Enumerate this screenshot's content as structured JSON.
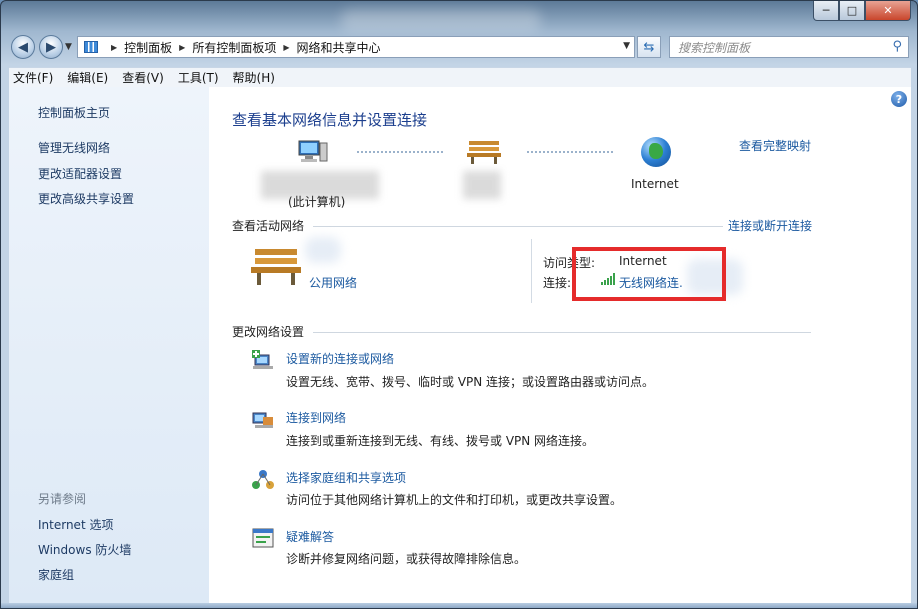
{
  "window": {
    "title": "",
    "caption_minimize": "─",
    "caption_maximize": "□",
    "caption_close": "✕"
  },
  "address_bar": {
    "breadcrumbs": [
      "控制面板",
      "所有控制面板项",
      "网络和共享中心"
    ],
    "search_placeholder": "搜索控制面板"
  },
  "menu": [
    "文件(F)",
    "编辑(E)",
    "查看(V)",
    "工具(T)",
    "帮助(H)"
  ],
  "sidebar": {
    "home": "控制面板主页",
    "links": [
      "管理无线网络",
      "更改适配器设置",
      "更改高级共享设置"
    ],
    "see_also_title": "另请参阅",
    "see_also": [
      "Internet 选项",
      "Windows 防火墙",
      "家庭组"
    ]
  },
  "main": {
    "title": "查看基本网络信息并设置连接",
    "full_map_link": "查看完整映射",
    "map": {
      "computer_label": "(此计算机)",
      "internet_label": "Internet"
    },
    "active_networks": {
      "heading": "查看活动网络",
      "connect_link": "连接或断开连接",
      "network_type": "公用网络",
      "access_type_label": "访问类型:",
      "access_type_value": "Internet",
      "connection_label": "连接:",
      "connection_value": "无线网络连."
    },
    "change_settings": {
      "heading": "更改网络设置",
      "tasks": [
        {
          "icon": "new-connection-icon",
          "title": "设置新的连接或网络",
          "desc": "设置无线、宽带、拨号、临时或 VPN 连接；或设置路由器或访问点。"
        },
        {
          "icon": "connect-network-icon",
          "title": "连接到网络",
          "desc": "连接到或重新连接到无线、有线、拨号或 VPN 网络连接。"
        },
        {
          "icon": "homegroup-icon",
          "title": "选择家庭组和共享选项",
          "desc": "访问位于其他网络计算机上的文件和打印机，或更改共享设置。"
        },
        {
          "icon": "troubleshoot-icon",
          "title": "疑难解答",
          "desc": "诊断并修复网络问题，或获得故障排除信息。"
        }
      ]
    }
  },
  "colors": {
    "link": "#1c5aa0",
    "title": "#1c3f8e",
    "highlight": "#e52b2b",
    "wifi": "#3aa24b"
  }
}
